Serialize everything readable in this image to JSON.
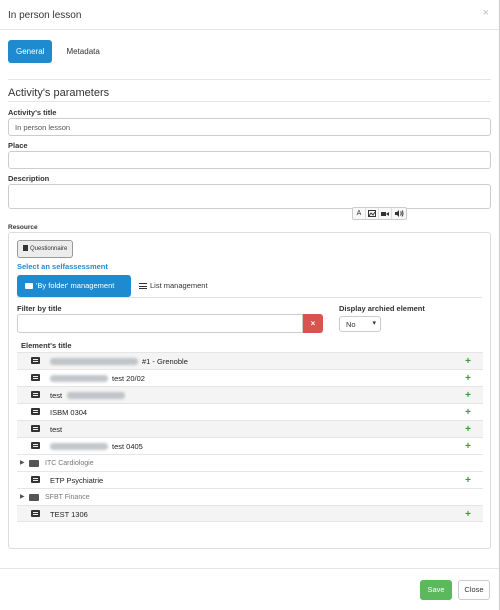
{
  "modal": {
    "title": "In person lesson",
    "close_symbol": "×"
  },
  "tabs": [
    {
      "label": "General",
      "active": true
    },
    {
      "label": "Metadata",
      "active": false
    }
  ],
  "section_title": "Activity's parameters",
  "form": {
    "title_label": "Activity's title",
    "title_value": "In person lesson",
    "place_label": "Place",
    "place_value": "",
    "description_label": "Description",
    "description_value": ""
  },
  "editor_tools": [
    "A",
    "image-icon",
    "video-icon",
    "audio-icon"
  ],
  "resource": {
    "label": "Resource",
    "questionnaire_button": "Questionnaire",
    "select_link": "Select an selfassessment",
    "folder_mgmt": "'By folder' management",
    "list_mgmt": "List management",
    "filter_label": "Filter by title",
    "filter_value": "",
    "clear_symbol": "×",
    "archived_label": "Display archied element",
    "archived_value": "No",
    "element_title_label": "Element's title"
  },
  "elements": [
    {
      "type": "item",
      "text": "#1 - Grenoble",
      "blur_w": 90,
      "shade": true
    },
    {
      "type": "item",
      "text": "test 20/02",
      "blur_w": 62,
      "shade": false
    },
    {
      "type": "item",
      "text": "test",
      "blur_w": 0,
      "shade": true
    },
    {
      "type": "item",
      "text": "ISBM 0304",
      "blur_w": 0,
      "shade": false
    },
    {
      "type": "item",
      "text": "test",
      "blur_w": 0,
      "shade": true
    },
    {
      "type": "item",
      "text": "test 0405",
      "blur_w": 58,
      "shade": false
    },
    {
      "type": "folder",
      "text": "ITC Cardiologie",
      "shade": false
    },
    {
      "type": "item",
      "text": "ETP Psychiatrie",
      "blur_w": 0,
      "shade": false
    },
    {
      "type": "folder",
      "text": "SFBT Finance",
      "shade": false
    },
    {
      "type": "item",
      "text": "TEST 1306",
      "blur_w": 0,
      "shade": true
    }
  ],
  "footer": {
    "save": "Save",
    "close": "Close"
  },
  "colors": {
    "primary": "#1e8bd0",
    "danger": "#d9534f",
    "success": "#5cb85c"
  }
}
